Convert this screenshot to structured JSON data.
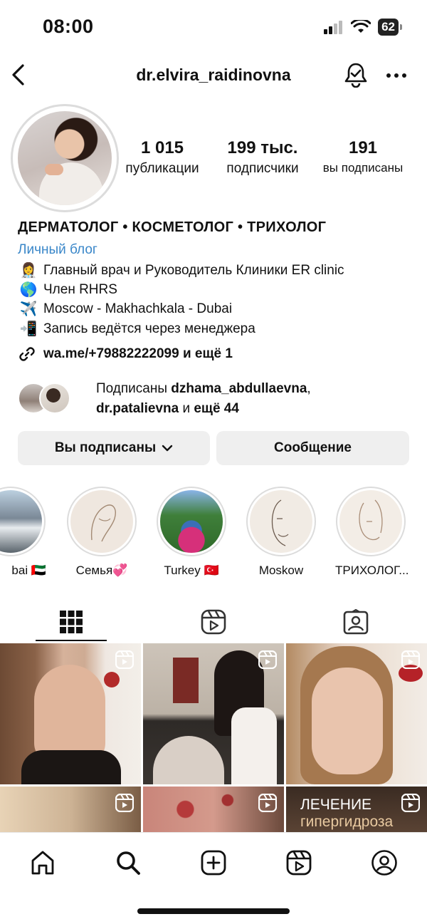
{
  "status_bar": {
    "time": "08:00",
    "battery": "62"
  },
  "header": {
    "username": "dr.elvira_raidinovna",
    "icons": [
      "back-icon",
      "notification-bell-icon",
      "more-icon"
    ]
  },
  "stats": [
    {
      "value": "1 015",
      "label": "публикации"
    },
    {
      "value": "199 тыс.",
      "label": "подписчики"
    },
    {
      "value": "191",
      "label": "вы подписаны"
    }
  ],
  "bio": {
    "title": "ДЕРМАТОЛОГ • КОСМЕТОЛОГ • ТРИХОЛОГ",
    "category": "Личный блог",
    "lines": [
      {
        "emoji": "👩‍⚕️",
        "text": "Главный врач и Руководитель Клиники ER clinic"
      },
      {
        "emoji": "🌎",
        "text": "Член RHRS"
      },
      {
        "emoji": "✈️",
        "text": "Moscow - Makhachkala - Dubai"
      },
      {
        "emoji": "📲",
        "text": "Запись ведётся через менеджера"
      }
    ],
    "link": "wa.me/+79882222099 и ещё 1"
  },
  "followed_by": {
    "prefix": "Подписаны ",
    "user1": "dzhama_abdullaevna",
    "sep": ",",
    "user2": "dr.patalievna",
    "suffix": " и ",
    "more": "ещё 44"
  },
  "buttons": {
    "following": "Вы подписаны",
    "message": "Сообщение"
  },
  "highlights": [
    {
      "label": "bai 🇦🇪"
    },
    {
      "label": "Семья💞"
    },
    {
      "label": "Turkey 🇹🇷"
    },
    {
      "label": "Moskow"
    },
    {
      "label": "ТРИХОЛОГ..."
    }
  ],
  "tabs": [
    "grid-icon",
    "reels-icon",
    "tagged-icon"
  ],
  "grid_posts": [
    {
      "type": "reel",
      "caption": ""
    },
    {
      "type": "reel",
      "caption": ""
    },
    {
      "type": "reel",
      "caption": ""
    },
    {
      "type": "reel",
      "caption": ""
    },
    {
      "type": "reel",
      "caption": ""
    },
    {
      "type": "reel",
      "caption_line1": "ЛЕЧЕНИЕ",
      "caption_line2": "гипергидроза"
    }
  ],
  "bottom_nav": [
    "home-icon",
    "search-icon",
    "create-icon",
    "reels-icon",
    "profile-icon"
  ]
}
